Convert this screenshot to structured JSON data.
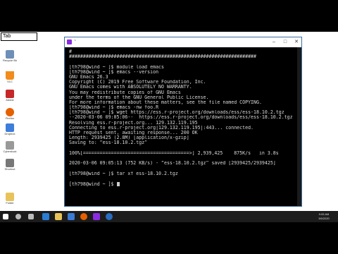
{
  "taskbar_input": {
    "value": "Tab"
  },
  "desktop_left_icons": [
    {
      "label": "Recycle Bin",
      "icon": "recycle-bin-icon",
      "color": "#6d8fb8"
    },
    {
      "label": "VLC",
      "icon": "vlc-icon",
      "color": "#f28c1c"
    },
    {
      "label": "Adobe",
      "icon": "adobe-icon",
      "color": "#c62828"
    },
    {
      "label": "Firefox",
      "icon": "firefox-icon",
      "color": "#e66000"
    },
    {
      "label": "Dropbox",
      "icon": "dropbox-icon",
      "color": "#3d7edb"
    },
    {
      "label": "Cyberduck",
      "icon": "cyberduck-icon",
      "color": "#999999"
    },
    {
      "label": "Shortcut",
      "icon": "shortcut-icon",
      "color": "#777777"
    },
    {
      "label": "Folder",
      "icon": "folder-icon",
      "color": "#e8c35a"
    }
  ],
  "terminal": {
    "title": "~",
    "lines": [
      "#",
      "###################################################################",
      "",
      "[th798@wind ~ ]$ module load emacs",
      "[th798@wind ~ ]$ emacs --version",
      "GNU Emacs 26.3",
      "Copyright (C) 2019 Free Software Foundation, Inc.",
      "GNU Emacs comes with ABSOLUTELY NO WARRANTY.",
      "You may redistribute copies of GNU Emacs",
      "under the terms of the GNU General Public License.",
      "For more information about these matters, see the file named COPYING.",
      "[th798@wind ~ ]$ emacs -nw foo.R",
      "[th798@wind ~ ]$ wget https://ess.r-project.org/downloads/ess/ess-18.10.2.tgz",
      "--2020-03-06 09:05:06--  https://ess.r-project.org/downloads/ess/ess-18.10.2.tgz",
      "Resolving ess.r-project.org... 129.132.119.195",
      "Connecting to ess.r-project.org|129.132.119.195|:443... connected.",
      "HTTP request sent, awaiting response... 200 OK",
      "Length: 2939425 (2.8M) [application/x-gzip]",
      "Saving to: “ess-18.10.2.tgz”",
      "",
      "100%[======================================>] 2,939,425    875K/s   in 3.8s",
      "",
      "2020-03-06 09:05:13 (752 KB/s) - “ess-18.10.2.tgz” saved [2939425/2939425]",
      "",
      "[th798@wind ~ ]$ tar xf ess-18.10.2.tgz",
      "[th798@wind ~ ]$ "
    ]
  },
  "taskbar_items": [
    {
      "icon": "start-icon",
      "color": "#ffffff"
    },
    {
      "icon": "search-icon",
      "color": "#bbbbbb"
    },
    {
      "icon": "task-view-icon",
      "color": "#bbbbbb"
    },
    {
      "icon": "edge-icon",
      "color": "#2b7cd3"
    },
    {
      "icon": "explorer-icon",
      "color": "#e8c35a"
    },
    {
      "icon": "store-icon",
      "color": "#3a7bd5"
    },
    {
      "icon": "firefox-icon",
      "color": "#e66000"
    },
    {
      "icon": "terminal-icon",
      "color": "#8a2be2"
    },
    {
      "icon": "r-icon",
      "color": "#276dc3"
    }
  ],
  "clock": {
    "time": "9:05 AM",
    "date": "3/6/2020"
  }
}
